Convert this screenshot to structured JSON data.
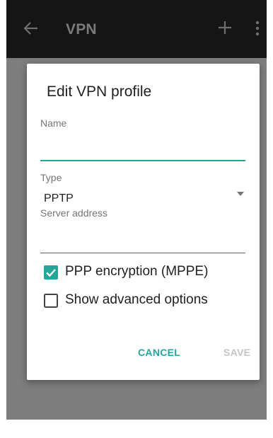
{
  "appbar": {
    "title": "VPN",
    "back_icon": "arrow-back-icon",
    "add_icon": "plus-icon",
    "more_icon": "overflow-menu-icon"
  },
  "dialog": {
    "title": "Edit VPN profile",
    "name_label": "Name",
    "name_value": "",
    "type_label": "Type",
    "type_value": "PPTP",
    "server_label": "Server address",
    "server_value": "",
    "ppp_encryption_label": "PPP encryption (MPPE)",
    "ppp_encryption_checked": true,
    "advanced_label": "Show advanced options",
    "advanced_checked": false,
    "cancel_label": "CANCEL",
    "save_label": "SAVE"
  },
  "colors": {
    "accent": "#26a69a",
    "disabled": "#c6c6c6",
    "appbar": "#151515",
    "scrim": "#7d7d7d"
  }
}
